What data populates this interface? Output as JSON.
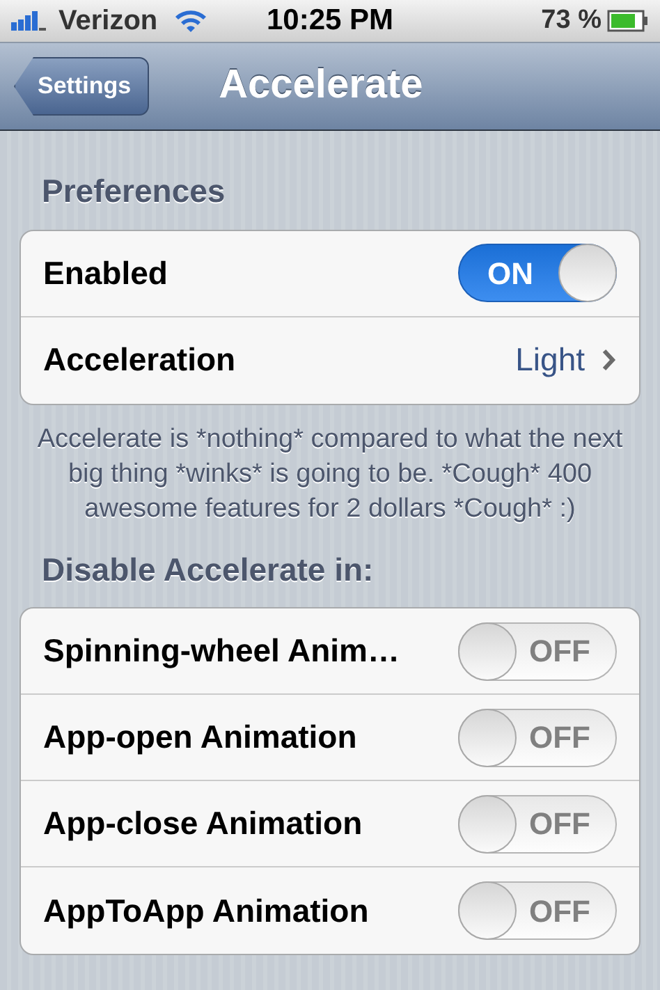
{
  "status_bar": {
    "carrier": "Verizon",
    "time": "10:25 PM",
    "battery": "73 %"
  },
  "nav": {
    "back": "Settings",
    "title": "Accelerate"
  },
  "sections": [
    {
      "header": "Preferences",
      "rows": [
        {
          "kind": "toggle",
          "label": "Enabled",
          "on": true,
          "toggle_label": "ON"
        },
        {
          "kind": "link",
          "label": "Acceleration",
          "value": "Light"
        }
      ],
      "footer": "Accelerate is *nothing* compared to what the next big thing *winks* is going to be. *Cough* 400 awesome features for 2 dollars *Cough* :)"
    },
    {
      "header": "Disable Accelerate in:",
      "rows": [
        {
          "kind": "toggle",
          "label": "Spinning-wheel Anim…",
          "on": false,
          "toggle_label": "OFF"
        },
        {
          "kind": "toggle",
          "label": "App-open Animation",
          "on": false,
          "toggle_label": "OFF"
        },
        {
          "kind": "toggle",
          "label": "App-close Animation",
          "on": false,
          "toggle_label": "OFF"
        },
        {
          "kind": "toggle",
          "label": "AppToApp Animation",
          "on": false,
          "toggle_label": "OFF"
        }
      ]
    }
  ]
}
